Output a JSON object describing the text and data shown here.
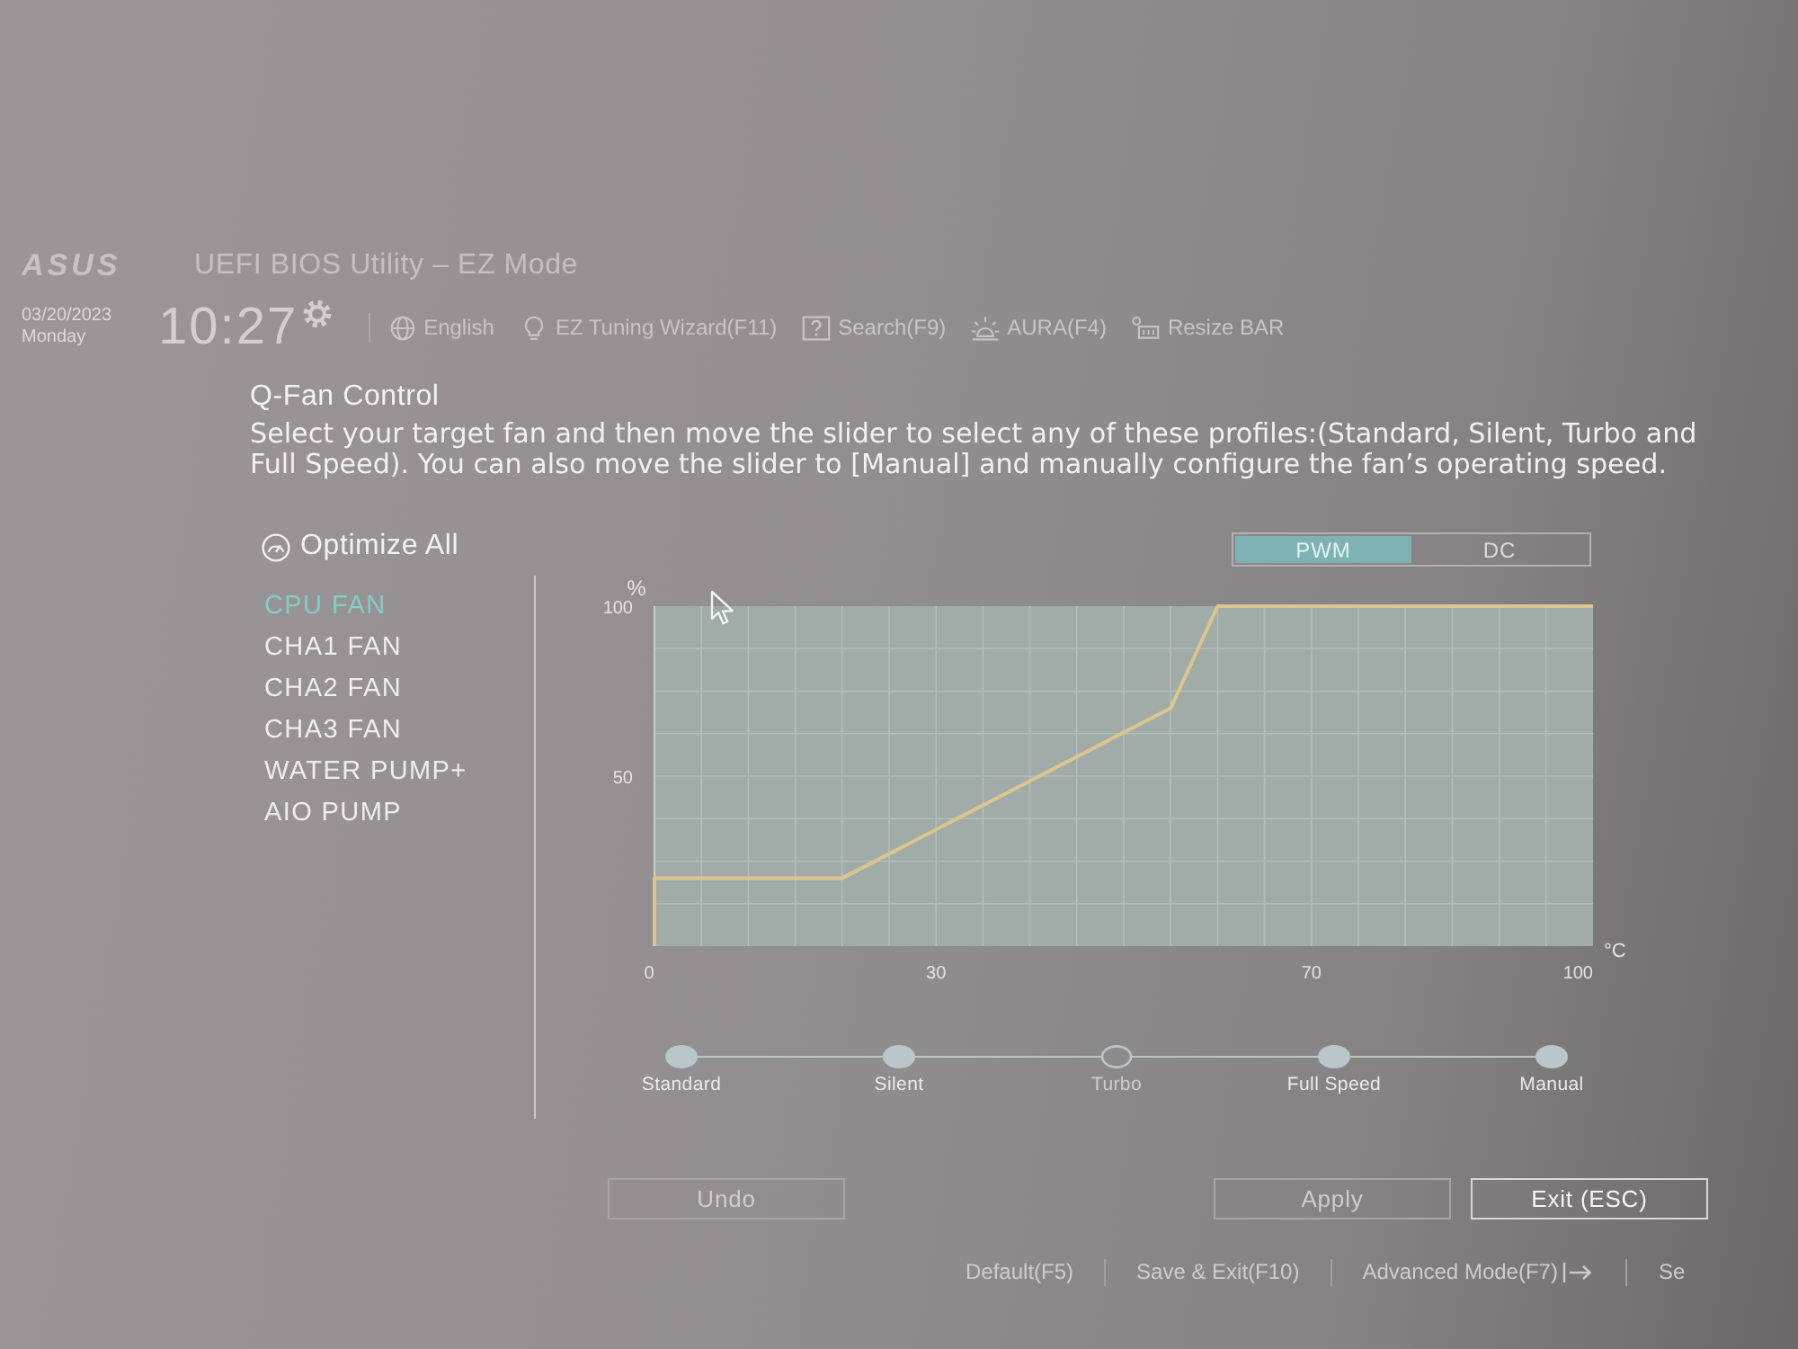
{
  "header": {
    "logo": "ASUS",
    "title": "UEFI BIOS Utility – EZ Mode",
    "date": "03/20/2023",
    "day": "Monday",
    "time": "10:27",
    "toolbar": [
      {
        "kind": "language",
        "label": "English"
      },
      {
        "kind": "wizard",
        "label": "EZ Tuning Wizard(F11)"
      },
      {
        "kind": "search",
        "label": "Search(F9)"
      },
      {
        "kind": "aura",
        "label": "AURA(F4)"
      },
      {
        "kind": "resizebar",
        "label": "Resize BAR"
      }
    ]
  },
  "qfan": {
    "title": "Q-Fan Control",
    "description": "Select your target fan and then move the slider to select any of these profiles:(Standard, Silent, Turbo and Full Speed). You can also move the slider to [Manual] and manually configure the fan’s operating speed.",
    "optimize": "Optimize All",
    "fans": [
      {
        "label": "CPU FAN",
        "selected": true
      },
      {
        "label": "CHA1 FAN",
        "selected": false
      },
      {
        "label": "CHA2 FAN",
        "selected": false
      },
      {
        "label": "CHA3 FAN",
        "selected": false
      },
      {
        "label": "WATER PUMP+",
        "selected": false
      },
      {
        "label": "AIO PUMP",
        "selected": false
      }
    ],
    "mode_tabs": [
      {
        "label": "PWM",
        "selected": true
      },
      {
        "label": "DC",
        "selected": false
      }
    ],
    "chart_data": {
      "type": "line",
      "xlabel": "°C",
      "ylabel": "%",
      "x": [
        0,
        0,
        20,
        55,
        60,
        100
      ],
      "values": [
        0,
        20,
        20,
        70,
        100,
        100
      ],
      "color": "#dcc690",
      "xlim": [
        0,
        100
      ],
      "ylim": [
        0,
        100
      ],
      "xticks": [
        0,
        30,
        70,
        100
      ],
      "yticks": [
        50,
        100
      ],
      "grid": true
    },
    "profiles": [
      {
        "label": "Standard",
        "selected": false
      },
      {
        "label": "Silent",
        "selected": false
      },
      {
        "label": "Turbo",
        "selected": true
      },
      {
        "label": "Full Speed",
        "selected": false
      },
      {
        "label": "Manual",
        "selected": false
      }
    ]
  },
  "buttons": [
    {
      "label": "Undo",
      "disabled": true
    },
    {
      "label": "Apply",
      "disabled": true
    },
    {
      "label": "Exit (ESC)",
      "disabled": false
    }
  ],
  "footer": [
    {
      "kind": "plain",
      "label": "Default(F5)"
    },
    {
      "kind": "plain",
      "label": "Save & Exit(F10)"
    },
    {
      "kind": "exit",
      "label": "Advanced Mode(F7)"
    },
    {
      "kind": "plain",
      "label": "Se"
    }
  ]
}
